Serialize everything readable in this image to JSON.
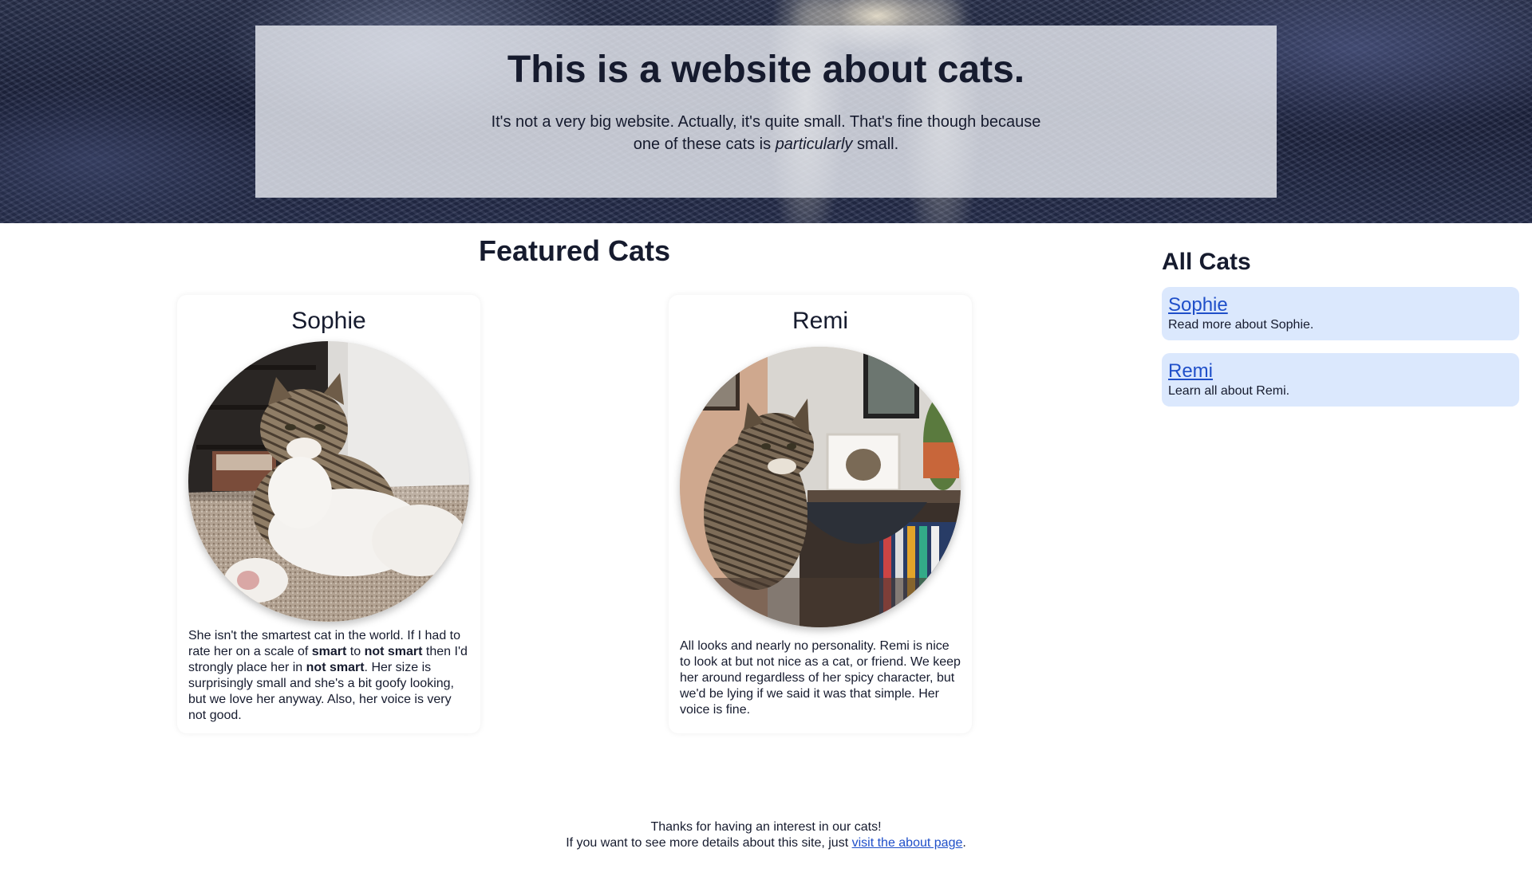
{
  "hero": {
    "title": "This is a website about cats.",
    "subtitle_part1": "It's not a very big website. Actually, it's quite small. That's fine though because one of these cats is ",
    "subtitle_emphasis": "particularly",
    "subtitle_part2": " small."
  },
  "featured": {
    "title": "Featured Cats",
    "cards": [
      {
        "name": "Sophie",
        "desc": [
          {
            "text": "She isn't the smartest cat in the world. If I had to rate her on a scale of ",
            "bold": false
          },
          {
            "text": "smart",
            "bold": true
          },
          {
            "text": " to ",
            "bold": false
          },
          {
            "text": "not smart",
            "bold": true
          },
          {
            "text": " then I'd strongly place her in ",
            "bold": false
          },
          {
            "text": "not smart",
            "bold": true
          },
          {
            "text": ". Her size is surprisingly small and she's a bit goofy looking, but we love her anyway. Also, her voice is very not good.",
            "bold": false
          }
        ]
      },
      {
        "name": "Remi",
        "desc": [
          {
            "text": "All looks and nearly no personality. Remi is nice to look at but not nice as a cat, or friend. We keep her around regardless of her spicy character, but we'd be lying if we said it was that simple. Her voice is fine.",
            "bold": false
          }
        ]
      }
    ]
  },
  "sidebar": {
    "title": "All Cats",
    "items": [
      {
        "label": "Sophie",
        "desc": "Read more about Sophie."
      },
      {
        "label": "Remi",
        "desc": "Learn all about Remi."
      }
    ]
  },
  "footer": {
    "line1": "Thanks for having an interest in our cats!",
    "line2_prefix": "If you want to see more details about this site, just ",
    "link_label": "visit the about page",
    "line2_suffix": "."
  },
  "colors": {
    "link": "#1f4fc9",
    "sidebar_item_bg": "#dbe8fd",
    "text": "#161b2e"
  }
}
